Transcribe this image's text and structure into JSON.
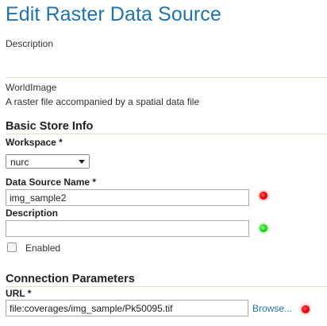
{
  "page": {
    "title": "Edit Raster Data Source",
    "description_label": "Description"
  },
  "store_type": {
    "name": "WorldImage",
    "summary": "A raster file accompanied by a spatial data file"
  },
  "basic_store_info": {
    "heading": "Basic Store Info",
    "workspace_label": "Workspace *",
    "workspace_value": "nurc",
    "data_source_name_label": "Data Source Name *",
    "data_source_name_value": "img_sample2",
    "description_label": "Description",
    "description_value": "",
    "enabled_label": "Enabled",
    "enabled_checked": false
  },
  "connection_parameters": {
    "heading": "Connection Parameters",
    "url_label": "URL *",
    "url_value": "file:coverages/img_sample/Pk50095.tif",
    "browse_label": "Browse..."
  },
  "indicators": {
    "data_source_name_status": "red",
    "description_status": "green",
    "url_status": "red"
  },
  "colors": {
    "title": "#1d73b4",
    "link": "#1d73b4",
    "status_red": "#e00000",
    "status_green": "#1ec81e"
  }
}
